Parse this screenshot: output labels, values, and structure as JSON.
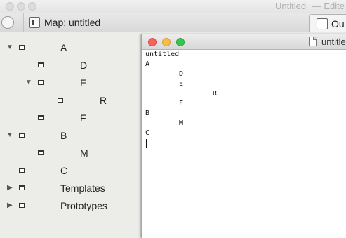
{
  "back_window": {
    "title": "Untitled",
    "title_suffix": "— Edite",
    "map_tab_label": "Map: untitled",
    "outline_tab_label": "Ou",
    "map_icon": "map-hierarchy-icon",
    "outline_icon": "outline-document-icon"
  },
  "tree": [
    {
      "label": "A",
      "expanded": true
    },
    {
      "label": "D"
    },
    {
      "label": "E",
      "expanded": true
    },
    {
      "label": "R"
    },
    {
      "label": "F"
    },
    {
      "label": "B",
      "expanded": true
    },
    {
      "label": "M"
    },
    {
      "label": "C"
    },
    {
      "label": "Templates",
      "expanded": false
    },
    {
      "label": "Prototypes",
      "expanded": false
    }
  ],
  "front_window": {
    "title": "untitled",
    "lines": [
      "untitled",
      "A",
      "D",
      "E",
      "R",
      "F",
      "B",
      "M",
      "C"
    ]
  },
  "colors": {
    "close": "#fc605c",
    "minimize": "#fdbc40",
    "zoom": "#34c84a"
  }
}
